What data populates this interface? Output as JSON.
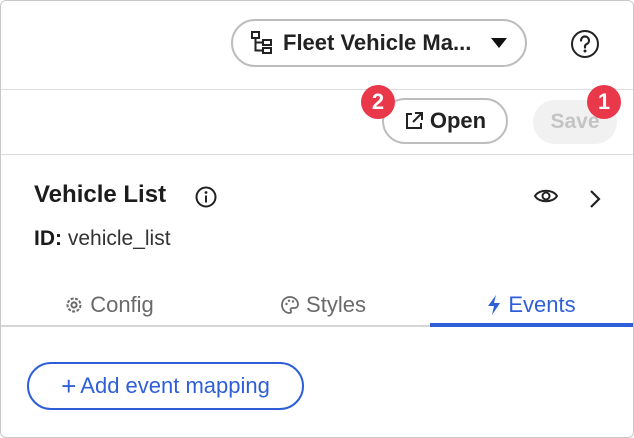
{
  "header": {
    "dataset_selector_label": "Fleet Vehicle Ma...",
    "help_icon": "help-circle-icon"
  },
  "actions": {
    "open_label": "Open",
    "save_label": "Save",
    "badges": {
      "save": "1",
      "open": "2"
    }
  },
  "component": {
    "title": "Vehicle List",
    "id_label": "ID:",
    "id_value": "vehicle_list"
  },
  "tabs": [
    {
      "label": "Config",
      "icon": "gear-icon",
      "active": false
    },
    {
      "label": "Styles",
      "icon": "palette-icon",
      "active": false
    },
    {
      "label": "Events",
      "icon": "lightning-icon",
      "active": true
    }
  ],
  "events": {
    "add_label": "Add event mapping"
  },
  "colors": {
    "accent": "#2f5fd8",
    "badge": "#e8384a"
  }
}
